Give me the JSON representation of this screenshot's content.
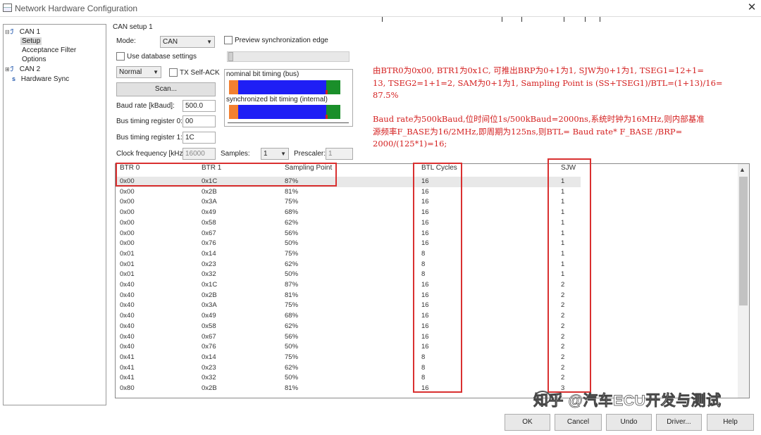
{
  "window": {
    "title": "Network Hardware Configuration"
  },
  "tree": {
    "items": [
      {
        "label": "CAN 1",
        "expander": "⊟",
        "icon": "can-network-icon"
      },
      {
        "label": "Setup",
        "selected": true
      },
      {
        "label": "Acceptance Filter"
      },
      {
        "label": "Options"
      },
      {
        "label": "CAN 2",
        "expander": "⊞",
        "icon": "can-network-icon"
      },
      {
        "label": "Hardware Sync",
        "icon": "sync-icon"
      }
    ]
  },
  "setup": {
    "group_label": "CAN setup 1",
    "mode_label": "Mode:",
    "mode_value": "CAN",
    "preview_label": "Preview synchronization edge",
    "use_db_label": "Use database settings",
    "output_mode_value": "Normal",
    "tx_selfack_label": "TX Self-ACK",
    "scan_label": "Scan...",
    "baud_label": "Baud rate [kBaud]:",
    "baud_value": "500.0",
    "btr0_label": "Bus timing register 0:",
    "btr0_value": "00",
    "btr1_label": "Bus timing register 1:",
    "btr1_value": "1C",
    "clock_label": "Clock frequency [kHz]:",
    "clock_value": "16000",
    "samples_label": "Samples:",
    "samples_value": "1",
    "prescaler_label": "Prescaler:",
    "prescaler_value": "1"
  },
  "timing": {
    "nominal_label": "nominal bit timing (bus)",
    "sync_label": "synchronized bit timing (internal)",
    "colors": {
      "sync_seg": "#f28030",
      "tseg1": "#1e1ef5",
      "tseg2": "#1a8f2a",
      "sample_point": "#d02020"
    }
  },
  "note": {
    "lines": [
      "由BTR0为0x00, BTR1为0x1C,  可推出BRP为0+1为1,  SJW为0+1为1, TSEG1=12+1=",
      "13, TSEG2=1+1=2, SAM为0+1为1, Sampling Point is (SS+TSEG1)/BTL=(1+13)/16=",
      "87.5%",
      "",
      "Baud rate为500kBaud,位时间位1s/500kBaud=2000ns,系统时钟为16MHz,则内部基准",
      "源频率F_BASE为16/2MHz,即周期为125ns,则BTL= Baud rate* F_BASE /BRP=",
      "2000/(125*1)=16;"
    ],
    "color": "#d42020"
  },
  "table": {
    "headers": [
      "BTR 0",
      "BTR 1",
      "Sampling Point",
      "BTL Cycles",
      "SJW"
    ],
    "rows": [
      [
        "0x00",
        "0x1C",
        "87%",
        "16",
        "1"
      ],
      [
        "0x00",
        "0x2B",
        "81%",
        "16",
        "1"
      ],
      [
        "0x00",
        "0x3A",
        "75%",
        "16",
        "1"
      ],
      [
        "0x00",
        "0x49",
        "68%",
        "16",
        "1"
      ],
      [
        "0x00",
        "0x58",
        "62%",
        "16",
        "1"
      ],
      [
        "0x00",
        "0x67",
        "56%",
        "16",
        "1"
      ],
      [
        "0x00",
        "0x76",
        "50%",
        "16",
        "1"
      ],
      [
        "0x01",
        "0x14",
        "75%",
        "8",
        "1"
      ],
      [
        "0x01",
        "0x23",
        "62%",
        "8",
        "1"
      ],
      [
        "0x01",
        "0x32",
        "50%",
        "8",
        "1"
      ],
      [
        "0x40",
        "0x1C",
        "87%",
        "16",
        "2"
      ],
      [
        "0x40",
        "0x2B",
        "81%",
        "16",
        "2"
      ],
      [
        "0x40",
        "0x3A",
        "75%",
        "16",
        "2"
      ],
      [
        "0x40",
        "0x49",
        "68%",
        "16",
        "2"
      ],
      [
        "0x40",
        "0x58",
        "62%",
        "16",
        "2"
      ],
      [
        "0x40",
        "0x67",
        "56%",
        "16",
        "2"
      ],
      [
        "0x40",
        "0x76",
        "50%",
        "16",
        "2"
      ],
      [
        "0x41",
        "0x14",
        "75%",
        "8",
        "2"
      ],
      [
        "0x41",
        "0x23",
        "62%",
        "8",
        "2"
      ],
      [
        "0x41",
        "0x32",
        "50%",
        "8",
        "2"
      ],
      [
        "0x80",
        "0x2B",
        "81%",
        "16",
        "3"
      ]
    ]
  },
  "highlight_color": "#d93030",
  "watermark": "知乎 @汽车ECU开发与测试",
  "footer": {
    "ok": "OK",
    "cancel": "Cancel",
    "undo": "Undo",
    "driver": "Driver...",
    "help": "Help"
  }
}
